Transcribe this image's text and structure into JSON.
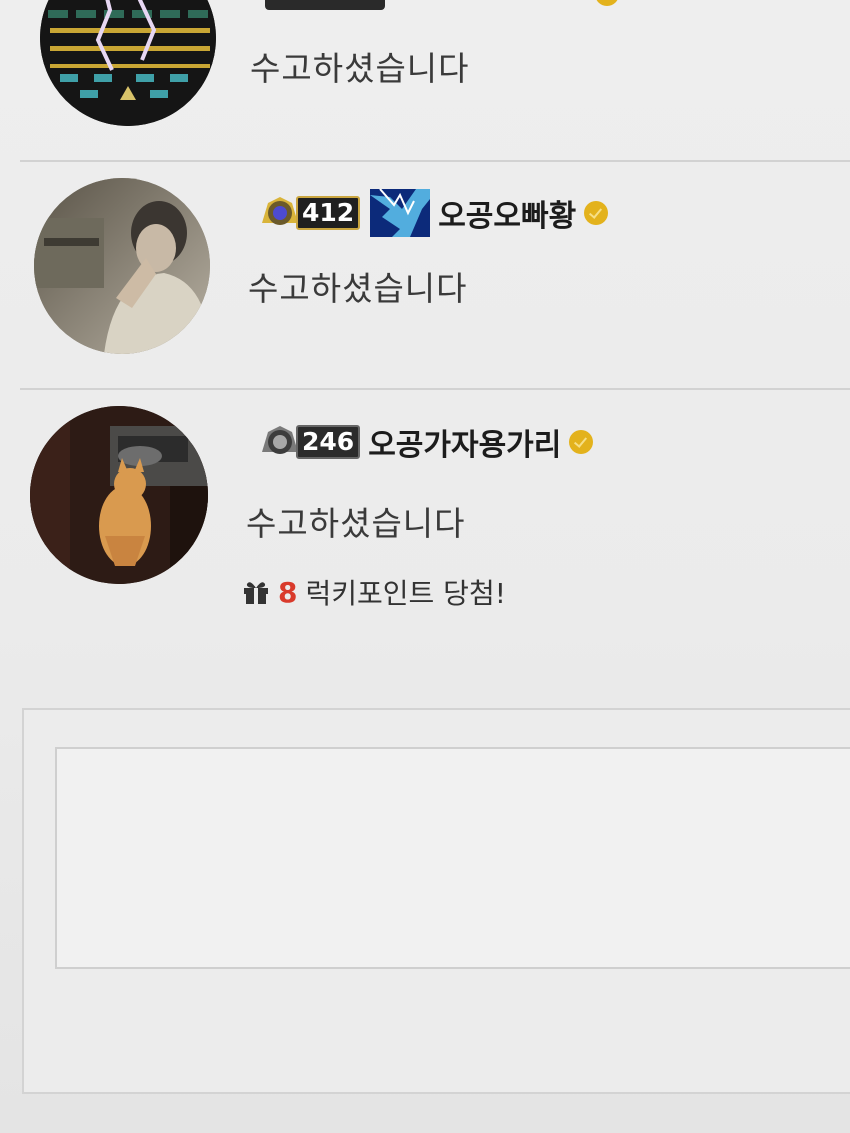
{
  "comments": [
    {
      "author": "",
      "text": "수고하셨습니다"
    },
    {
      "level": "412",
      "author": "오공오빠황",
      "text": "수고하셨습니다"
    },
    {
      "level": "246",
      "author": "오공가자용가리",
      "text": "수고하셨습니다",
      "lucky": {
        "points": "8",
        "label": "럭키포인트 당첨!"
      }
    }
  ],
  "comment_form": {
    "textarea_value": ""
  },
  "icons": {
    "verified": "verified-badge-icon",
    "lucky": "gift-icon",
    "level": "level-medal-icon"
  },
  "colors": {
    "verified": "#e3b21c",
    "lucky_number": "#d93a2b",
    "background": "#ebebeb"
  }
}
